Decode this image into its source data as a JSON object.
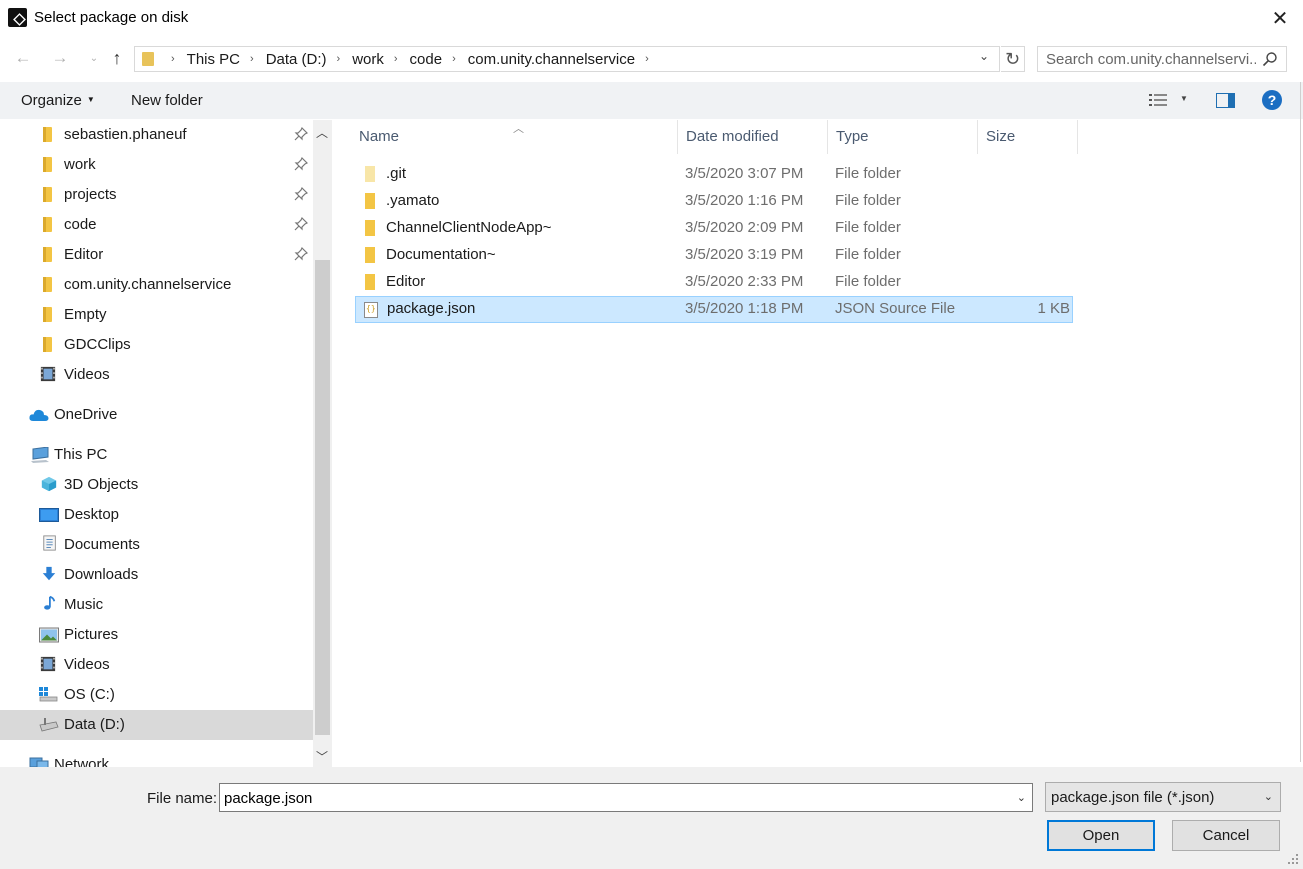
{
  "window": {
    "title": "Select package on disk",
    "close_glyph": "✕"
  },
  "nav": {
    "back_glyph": "←",
    "forward_glyph": "→",
    "recent_glyph": "⌄",
    "up_glyph": "↑",
    "breadcrumbs": [
      "This PC",
      "Data (D:)",
      "work",
      "code",
      "com.unity.channelservice"
    ],
    "crumb_separator": "›",
    "dropdown_glyph": "⌄",
    "refresh_glyph": "↻",
    "search_placeholder": "Search com.unity.channelservi..."
  },
  "command_bar": {
    "organize_label": "Organize",
    "organize_caret": "▼",
    "new_folder_label": "New folder",
    "view_caret": "▼",
    "help_glyph": "?"
  },
  "sidebar": {
    "scroll_up_glyph": "︿",
    "scroll_down_glyph": "﹀",
    "items": [
      {
        "label": "sebastien.phaneuf",
        "icon": "folder-icon",
        "pinned": true
      },
      {
        "label": "work",
        "icon": "folder-icon",
        "pinned": true
      },
      {
        "label": "projects",
        "icon": "folder-icon",
        "pinned": true
      },
      {
        "label": "code",
        "icon": "folder-icon",
        "pinned": true
      },
      {
        "label": "Editor",
        "icon": "folder-icon",
        "pinned": true
      },
      {
        "label": "com.unity.channelservice",
        "icon": "folder-icon",
        "pinned": false
      },
      {
        "label": "Empty",
        "icon": "folder-icon",
        "pinned": false
      },
      {
        "label": "GDCClips",
        "icon": "folder-icon",
        "pinned": false
      },
      {
        "label": "Videos",
        "icon": "videos-icon",
        "pinned": false
      },
      {
        "label": "OneDrive",
        "icon": "onedrive-icon",
        "pinned": false
      },
      {
        "label": "This PC",
        "icon": "computer-icon",
        "pinned": false
      },
      {
        "label": "3D Objects",
        "icon": "3d-objects-icon",
        "pinned": false
      },
      {
        "label": "Desktop",
        "icon": "desktop-icon",
        "pinned": false
      },
      {
        "label": "Documents",
        "icon": "documents-icon",
        "pinned": false
      },
      {
        "label": "Downloads",
        "icon": "downloads-icon",
        "pinned": false
      },
      {
        "label": "Music",
        "icon": "music-icon",
        "pinned": false
      },
      {
        "label": "Pictures",
        "icon": "pictures-icon",
        "pinned": false
      },
      {
        "label": "Videos",
        "icon": "videos-icon",
        "pinned": false
      },
      {
        "label": "OS (C:)",
        "icon": "os-drive-icon",
        "pinned": false
      },
      {
        "label": "Data (D:)",
        "icon": "drive-icon",
        "pinned": false,
        "selected": true
      },
      {
        "label": "Network",
        "icon": "network-icon",
        "pinned": false
      }
    ]
  },
  "file_list": {
    "sort_glyph": "︿",
    "columns": {
      "name": "Name",
      "date": "Date modified",
      "type": "Type",
      "size": "Size"
    },
    "rows": [
      {
        "name": ".git",
        "date": "3/5/2020 3:07 PM",
        "type": "File folder",
        "size": "",
        "icon": "folder-icon",
        "hidden": true
      },
      {
        "name": ".yamato",
        "date": "3/5/2020 1:16 PM",
        "type": "File folder",
        "size": "",
        "icon": "folder-icon"
      },
      {
        "name": "ChannelClientNodeApp~",
        "date": "3/5/2020 2:09 PM",
        "type": "File folder",
        "size": "",
        "icon": "folder-icon"
      },
      {
        "name": "Documentation~",
        "date": "3/5/2020 3:19 PM",
        "type": "File folder",
        "size": "",
        "icon": "folder-icon"
      },
      {
        "name": "Editor",
        "date": "3/5/2020 2:33 PM",
        "type": "File folder",
        "size": "",
        "icon": "folder-icon"
      },
      {
        "name": "package.json",
        "date": "3/5/2020 1:18 PM",
        "type": "JSON Source File",
        "size": "1 KB",
        "icon": "json-file-icon",
        "selected": true
      }
    ]
  },
  "footer": {
    "file_name_label": "File name:",
    "file_name_value": "package.json",
    "file_name_caret": "⌄",
    "filter_value": "package.json file (*.json)",
    "filter_caret": "⌄",
    "open_label": "Open",
    "cancel_label": "Cancel"
  },
  "colors": {
    "selection": "#cce8ff",
    "selection_border": "#99d1ff",
    "accent": "#0078d7",
    "folder": "#f3c544"
  }
}
